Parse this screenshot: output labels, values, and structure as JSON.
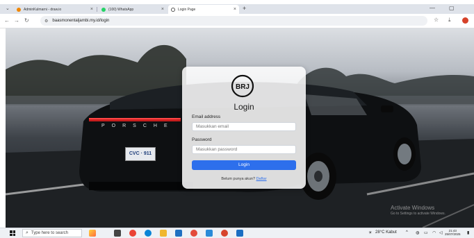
{
  "browser": {
    "tabs": [
      {
        "label": "AdminKulmarni - draw.io",
        "active": false,
        "favicon_color": "#f08705"
      },
      {
        "label": "(100) WhatsApp",
        "active": false,
        "favicon_color": "#25d366"
      },
      {
        "label": "Login Page",
        "active": true,
        "favicon_color": "#555555"
      }
    ],
    "new_tab": "+",
    "url": "baasmonentaljambi.my.id/login",
    "window_controls": [
      "—",
      "▢"
    ]
  },
  "login": {
    "logo_text": "BRJ",
    "title": "Login",
    "email_label": "Email address",
    "email_placeholder": "Masukkan email",
    "password_label": "Password",
    "password_placeholder": "Masukkan password",
    "submit_label": "Login",
    "register_prompt": "Belum punya akun?",
    "register_link": "Daftar"
  },
  "car": {
    "brand_text": "PORSCHE",
    "plate": "CVC · 911"
  },
  "watermark": {
    "line1": "Activate Windows",
    "line2": "Go to Settings to activate Windows."
  },
  "taskbar": {
    "search_placeholder": "Type here to search",
    "weather": "28°C Kabut",
    "time": "21:43",
    "date": "25/07/2025"
  },
  "colors": {
    "accent": "#2d6fec",
    "profile": "#d6422a"
  }
}
